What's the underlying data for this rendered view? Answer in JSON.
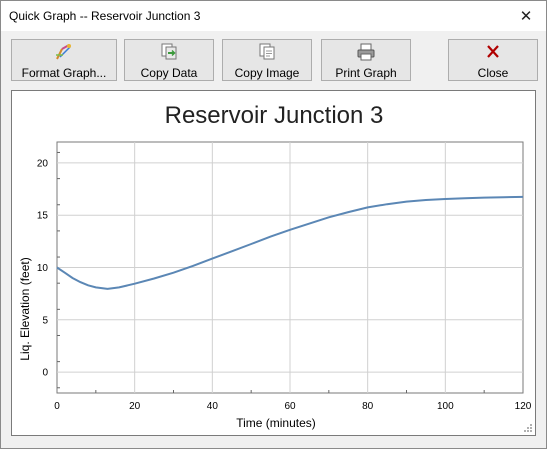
{
  "window": {
    "title": "Quick Graph -- Reservoir Junction 3",
    "close_glyph": "✕"
  },
  "toolbar": [
    {
      "id": "format",
      "label": "Format Graph...",
      "icon": "format-graph-icon"
    },
    {
      "id": "copy_data",
      "label": "Copy Data",
      "icon": "copy-data-icon"
    },
    {
      "id": "copy_image",
      "label": "Copy Image",
      "icon": "copy-image-icon"
    },
    {
      "id": "print",
      "label": "Print Graph",
      "icon": "printer-icon"
    },
    {
      "id": "close",
      "label": "Close",
      "icon": "close-icon"
    }
  ],
  "colors": {
    "series": "#5b87b5",
    "grid": "#d0d0d0",
    "close_icon": "#b00000"
  },
  "chart_data": {
    "type": "line",
    "title": "Reservoir Junction 3",
    "xlabel": "Time (minutes)",
    "ylabel": "Liq. Elevation (feet)",
    "xlim": [
      0,
      120
    ],
    "ylim": [
      -2,
      22
    ],
    "xticks": [
      0,
      20,
      40,
      60,
      80,
      100,
      120
    ],
    "yticks": [
      0,
      5,
      10,
      15,
      20
    ],
    "grid": true,
    "series": [
      {
        "x": [
          0,
          2,
          4,
          6,
          8,
          10,
          12,
          13,
          14,
          16,
          20,
          25,
          30,
          35,
          40,
          45,
          50,
          55,
          60,
          65,
          70,
          75,
          80,
          85,
          90,
          95,
          100,
          105,
          110,
          115,
          120
        ],
        "values": [
          10.0,
          9.5,
          9.0,
          8.6,
          8.3,
          8.1,
          8.0,
          7.95,
          8.0,
          8.1,
          8.45,
          8.95,
          9.5,
          10.15,
          10.85,
          11.55,
          12.25,
          12.95,
          13.6,
          14.2,
          14.8,
          15.3,
          15.75,
          16.05,
          16.3,
          16.45,
          16.55,
          16.62,
          16.68,
          16.72,
          16.75
        ]
      }
    ]
  }
}
